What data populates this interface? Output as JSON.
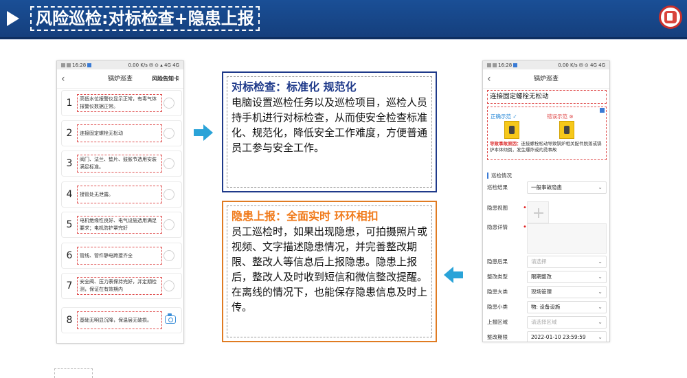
{
  "header": {
    "title": "风险巡检:对标检查+隐患上报"
  },
  "left_phone": {
    "status_time": "16:28",
    "status_right": "0.00 K/s  ✉ ⊙ ▴ 4G 4G",
    "nav_title": "锅炉巡查",
    "nav_right": "风险告知卡",
    "items": [
      {
        "num": "1",
        "text": "高低水位报警仪显示正常，有毒气体报警仪数据正常。"
      },
      {
        "num": "2",
        "text": "连接固定螺栓无松动"
      },
      {
        "num": "3",
        "text": "阀门、法兰、垫片、鼓胀节选用安装满足标准。"
      },
      {
        "num": "4",
        "text": "接管处无泄露。"
      },
      {
        "num": "5",
        "text": "电机绝缘性良好、电气设施选用满足要求；电机防护罩完好"
      },
      {
        "num": "6",
        "text": "管线、管件静电跨接齐全"
      },
      {
        "num": "7",
        "text": "安全阀、压力表保持完好，并定期检测，保证在有效期内"
      },
      {
        "num": "8",
        "text": "基础无明显沉降，保温层无破损。"
      }
    ]
  },
  "box_top": {
    "title": "对标检查：标准化 规范化",
    "body": "电脑设置巡检任务以及巡检项目，巡检人员持手机进行对标检查，从而使安全检查标准化、规范化，降低安全工作难度，方便普通员工参与安全工作。"
  },
  "box_bottom": {
    "title": "隐患上报：全面实时 环环相扣",
    "body": "员工巡检时，如果出现隐患，可拍摄照片或视频、文字描述隐患情况，并完善整改期限、整改人等信息后上报隐患。隐患上报后，整改人及时收到短信和微信整改提醒。在离线的情况下，也能保存隐患信息及时上传。"
  },
  "right_phone": {
    "status_time": "16:28",
    "status_right": "0.00 K/s ✉ ⊙ 4G 4G",
    "nav_title": "锅炉巡查",
    "field_title": "连接固定螺栓无松动",
    "correct_label": "正确示范",
    "wrong_label": "错误示范",
    "cause_label": "导致事故原因：",
    "cause_text": "连接螺栓松动导致锅炉相关配件脱落或锅炉本体倾倒，发生爆炸或灼烫事故",
    "section_title": "巡检情况",
    "rows": [
      {
        "label": "巡检结果",
        "value": "一般事故隐患",
        "placeholder": false,
        "required": false,
        "select": true
      },
      {
        "label": "隐患视图",
        "value": "",
        "placeholder": false,
        "required": true,
        "select": false
      },
      {
        "label": "隐患详情",
        "value": "",
        "placeholder": false,
        "required": true,
        "select": false
      },
      {
        "label": "隐患后果",
        "value": "请选择",
        "placeholder": true,
        "required": false,
        "select": true
      },
      {
        "label": "整改类型",
        "value": "限期整改",
        "placeholder": false,
        "required": false,
        "select": true
      },
      {
        "label": "隐患大类",
        "value": "现场管理",
        "placeholder": false,
        "required": false,
        "select": true
      },
      {
        "label": "隐患小类",
        "value": "物: 设备设施",
        "placeholder": false,
        "required": false,
        "select": true
      },
      {
        "label": "上报区域",
        "value": "请选择区域",
        "placeholder": true,
        "required": false,
        "select": true
      },
      {
        "label": "整改期限",
        "value": "2022-01-10 23:59:59",
        "placeholder": false,
        "required": false,
        "select": true
      }
    ]
  },
  "colors": {
    "header_bg": "#1a4f96",
    "top_box_border": "#1f3a8a",
    "top_title": "#1f3a8a",
    "bottom_box_border": "#e07b22",
    "bottom_title": "#f07a1a",
    "arrow": "#2aa3d8"
  },
  "icons": [
    "play-icon",
    "logo-icon",
    "back-icon",
    "radio-icon",
    "camera-icon",
    "arrow-right-icon",
    "arrow-left-icon",
    "chevron-down-icon",
    "plus-icon"
  ]
}
